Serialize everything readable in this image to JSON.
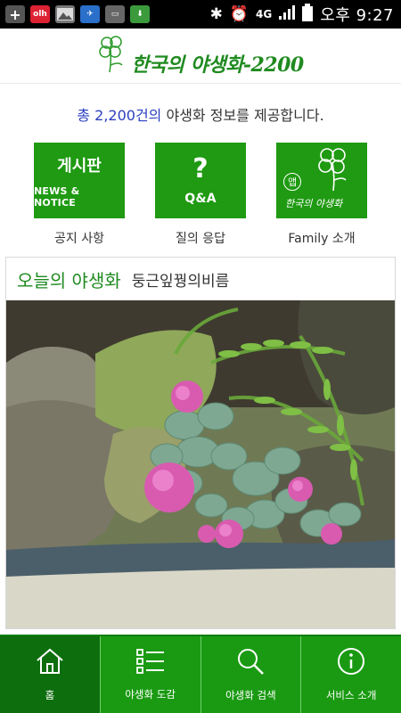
{
  "status_bar": {
    "time": "오후 9:27",
    "network": "4G",
    "icons": [
      "add-icon",
      "olleh-icon",
      "gallery-icon",
      "shuttle-icon",
      "battery-card-icon",
      "download-icon",
      "bluetooth-icon",
      "alarm-icon",
      "signal-icon",
      "battery-icon"
    ]
  },
  "header": {
    "title": "한국의 야생화-2200"
  },
  "intro": {
    "count_text": "총 2,200건의",
    "rest_text": " 야생화 정보를 제공합니다."
  },
  "quick_links": [
    {
      "box_main": "게시판",
      "box_sub": "NEWS & NOTICE",
      "label": "공지 사항"
    },
    {
      "box_main": "?",
      "box_sub": "Q&A",
      "label": "질의 응답"
    },
    {
      "box_main": "앱",
      "box_sub": "한국의 야생화",
      "label": "Family 소개"
    }
  ],
  "today_flower": {
    "heading": "오늘의 야생화",
    "name": "둥근잎꿩의비름"
  },
  "bottom_nav": [
    {
      "label": "홈",
      "icon": "home-icon",
      "active": true
    },
    {
      "label": "야생화 도감",
      "icon": "list-icon",
      "active": false
    },
    {
      "label": "야생화 검색",
      "icon": "search-icon",
      "active": false
    },
    {
      "label": "서비스 소개",
      "icon": "info-icon",
      "active": false
    }
  ],
  "colors": {
    "brand_green": "#1f9a12",
    "active_green": "#0d6e0d",
    "count_blue": "#2b3fbf"
  }
}
